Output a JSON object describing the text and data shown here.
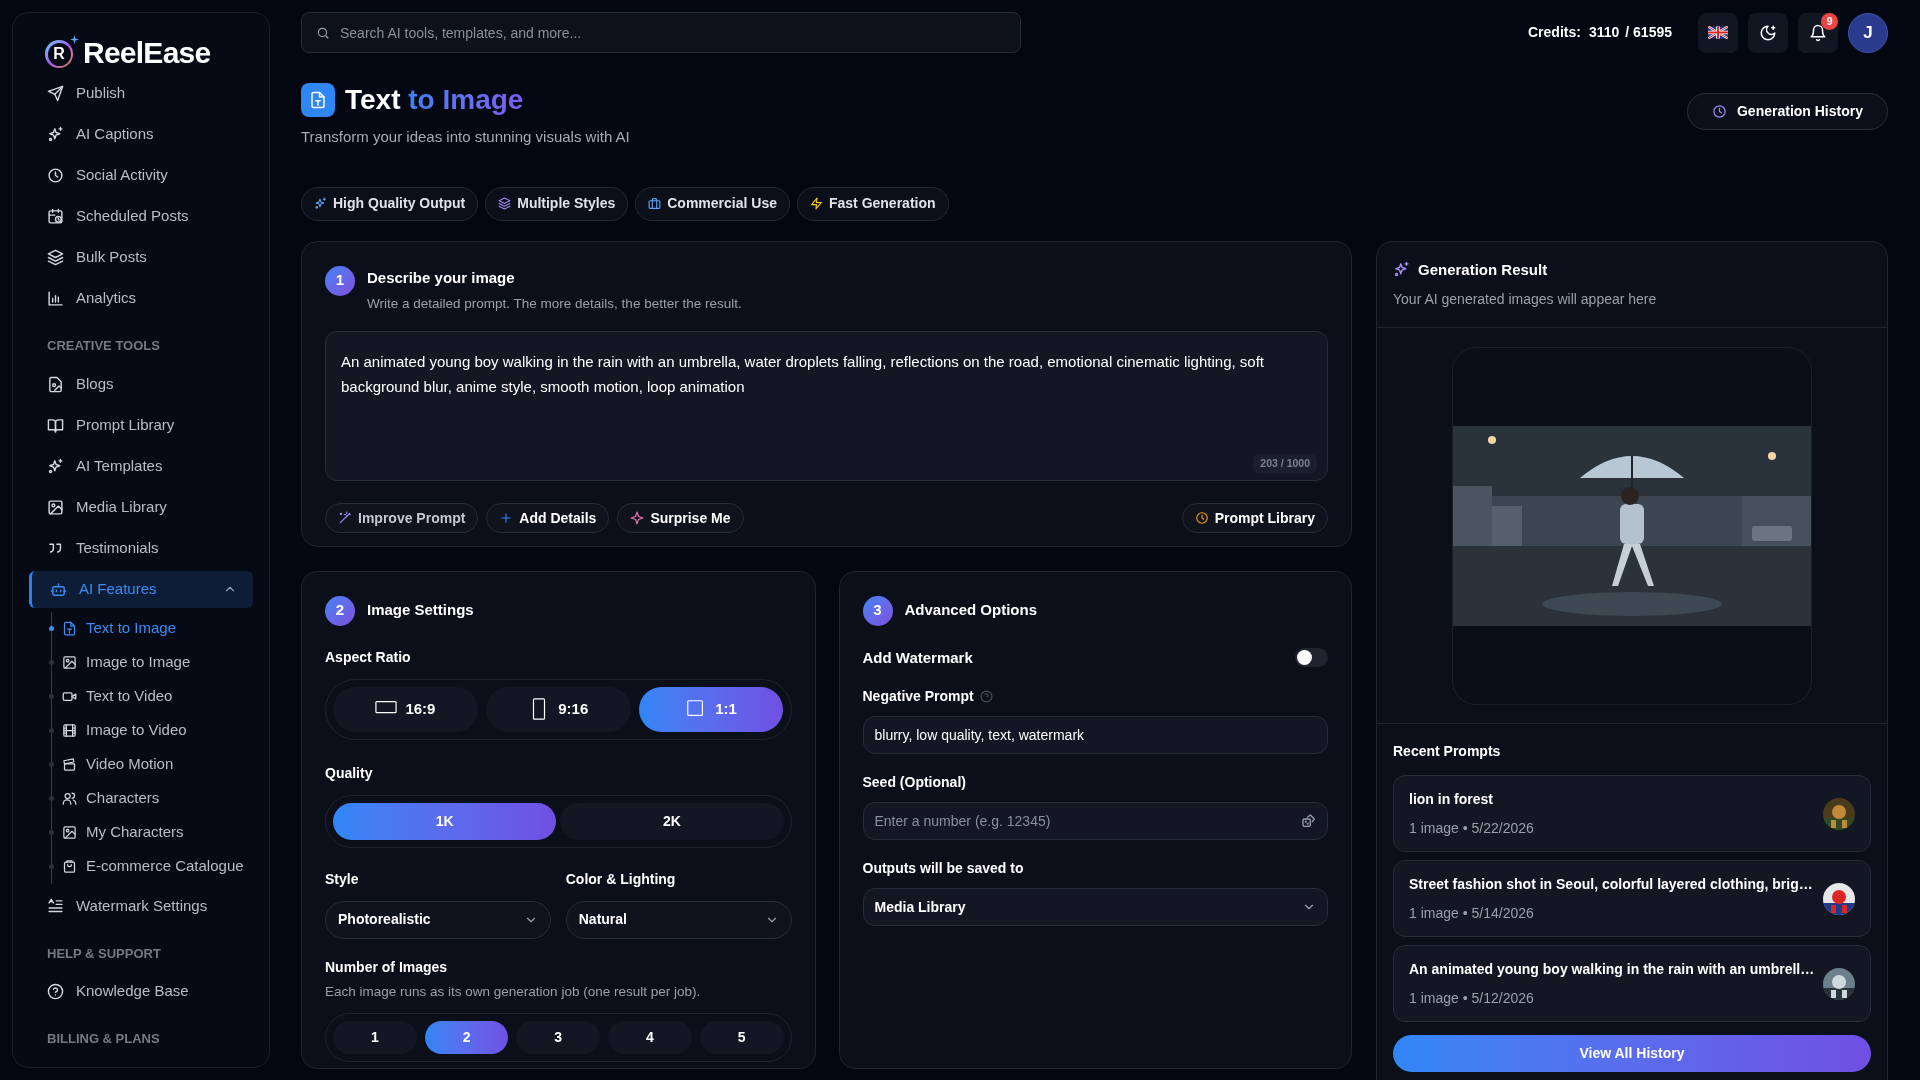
{
  "sidebar": {
    "logo_mark": "R",
    "logo_text": "ReelEase",
    "sections": [
      {
        "items": [
          {
            "label": "Publish",
            "selected": false
          },
          {
            "label": "AI Captions",
            "selected": false
          },
          {
            "label": "Social Activity",
            "selected": false
          },
          {
            "label": "Scheduled Posts",
            "selected": false
          },
          {
            "label": "Bulk Posts",
            "selected": false
          },
          {
            "label": "Analytics",
            "selected": false
          }
        ]
      },
      {
        "heading": "CREATIVE TOOLS",
        "items": [
          {
            "label": "Blogs",
            "selected": false
          },
          {
            "label": "Prompt Library",
            "selected": false
          },
          {
            "label": "AI Templates",
            "selected": false
          },
          {
            "label": "Media Library",
            "selected": false
          },
          {
            "label": "Testimonials",
            "selected": false
          },
          {
            "label": "AI Features",
            "selected": true,
            "expanded": true,
            "children": [
              {
                "label": "Text to Image",
                "selected": true
              },
              {
                "label": "Image to Image",
                "selected": false
              },
              {
                "label": "Text to Video",
                "selected": false
              },
              {
                "label": "Image to Video",
                "selected": false
              },
              {
                "label": "Video Motion",
                "selected": false
              },
              {
                "label": "Characters",
                "selected": false
              },
              {
                "label": "My Characters",
                "selected": false
              },
              {
                "label": "E-commerce Catalogue",
                "selected": false
              }
            ]
          },
          {
            "label": "Watermark Settings",
            "selected": false
          }
        ]
      },
      {
        "heading": "HELP & SUPPORT",
        "items": [
          {
            "label": "Knowledge Base",
            "selected": false
          }
        ]
      },
      {
        "heading": "BILLING & PLANS"
      }
    ]
  },
  "header": {
    "search": {
      "placeholder": "Search AI tools, templates, and more..."
    },
    "credits": {
      "label": "Credits:",
      "used": "3110",
      "total": "/ 61595"
    },
    "notifications": "9",
    "avatar": "J"
  },
  "page": {
    "title": "Text",
    "title_accent": "to Image",
    "subtitle": "Transform your ideas into stunning visuals with AI",
    "history_button": "Generation History",
    "features": [
      "High Quality Output",
      "Multiple Styles",
      "Commercial Use",
      "Fast Generation"
    ]
  },
  "describe": {
    "step": "1",
    "title": "Describe your image",
    "hint": "Write a detailed prompt. The more details, the better the result.",
    "prompt": "An animated young boy walking in the rain with an umbrella, water droplets falling, reflections on the road, emotional cinematic lighting, soft background blur, anime style, smooth motion, loop animation",
    "counter": "203 / 1000",
    "actions": [
      "Improve Prompt",
      "Add Details",
      "Surprise Me"
    ],
    "library_button": "Prompt Library"
  },
  "image_settings": {
    "step": "2",
    "title": "Image Settings",
    "aspect_ratio": {
      "label": "Aspect Ratio",
      "options": [
        {
          "label": "16:9",
          "kind": "landscape",
          "selected": false
        },
        {
          "label": "9:16",
          "kind": "portrait",
          "selected": false
        },
        {
          "label": "1:1",
          "kind": "square",
          "selected": true
        }
      ]
    },
    "quality": {
      "label": "Quality",
      "options": [
        {
          "label": "1K",
          "selected": true
        },
        {
          "label": "2K",
          "selected": false
        }
      ]
    },
    "style": {
      "label": "Style",
      "value": "Photorealistic"
    },
    "color_lighting": {
      "label": "Color & Lighting",
      "value": "Natural"
    },
    "images": {
      "label": "Number of Images",
      "hint": "Each image runs as its own generation job (one result per job).",
      "options": [
        {
          "label": "1",
          "selected": false
        },
        {
          "label": "2",
          "selected": true
        },
        {
          "label": "3",
          "selected": false
        },
        {
          "label": "4",
          "selected": false
        },
        {
          "label": "5",
          "selected": false
        }
      ]
    }
  },
  "advanced": {
    "step": "3",
    "title": "Advanced Options",
    "watermark": {
      "label": "Add Watermark",
      "on": false
    },
    "negative_prompt": {
      "label": "Negative Prompt",
      "value": "blurry, low quality, text, watermark"
    },
    "seed": {
      "label": "Seed (Optional)",
      "placeholder": "Enter a number (e.g. 12345)"
    },
    "outputs": {
      "label": "Outputs will be saved to",
      "value": "Media Library"
    }
  },
  "result": {
    "title": "Generation Result",
    "subtitle": "Your AI generated images will appear here",
    "recent_title": "Recent Prompts",
    "recent": [
      {
        "title": "lion in forest",
        "meta": "1 image • 5/22/2026"
      },
      {
        "title": "Street fashion shot in Seoul, colorful layered clothing, brig…",
        "meta": "1 image • 5/14/2026"
      },
      {
        "title": "An animated young boy walking in the rain with an umbrell…",
        "meta": "1 image • 5/12/2026"
      }
    ],
    "view_all": "View All History"
  }
}
